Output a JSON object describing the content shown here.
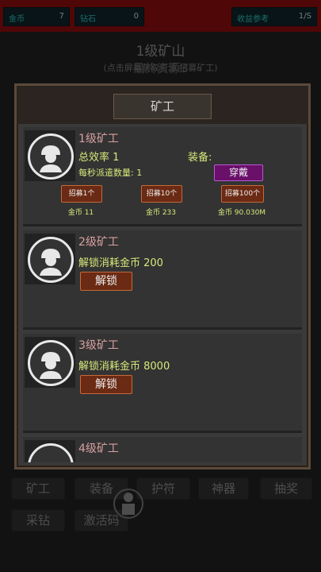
{
  "topbar": {
    "stats": [
      {
        "label": "金币",
        "value": "7"
      },
      {
        "label": "钻石",
        "value": "0"
      },
      {
        "label": "收益参考",
        "value": "1/S"
      }
    ]
  },
  "mine": {
    "title": "1级矿山",
    "subtitle": "(点击屏幕获取资源,招募矿工)",
    "overlay": "最终资源3"
  },
  "nav": {
    "row1": [
      "矿工",
      "装备",
      "护符",
      "神器",
      "抽奖"
    ],
    "row2": [
      "采钻",
      "激活码"
    ]
  },
  "panel": {
    "title": "矿工",
    "cards": [
      {
        "level": "1级矿工",
        "efficiency": "总效率 1",
        "dispatch": "每秒派遣数量: 1",
        "equip_label": "装备:",
        "equip_button": "穿戴",
        "recruit": [
          {
            "label": "招募1个",
            "cost": "金币 11"
          },
          {
            "label": "招募10个",
            "cost": "金币 233"
          },
          {
            "label": "招募100个",
            "cost": "金币 90.030M"
          }
        ]
      },
      {
        "level": "2级矿工",
        "unlock_text": "解锁消耗金币 200",
        "unlock_button": "解锁"
      },
      {
        "level": "3级矿工",
        "unlock_text": "解锁消耗金币 8000",
        "unlock_button": "解锁"
      },
      {
        "level": "4级矿工"
      }
    ]
  },
  "colors": {
    "accent_yellow": "#d8e87a",
    "level_pink": "#d9a0a0",
    "button_brown": "#6b2a14",
    "equip_purple": "#6a0f6a",
    "topbar_red": "#7a0c0c"
  }
}
